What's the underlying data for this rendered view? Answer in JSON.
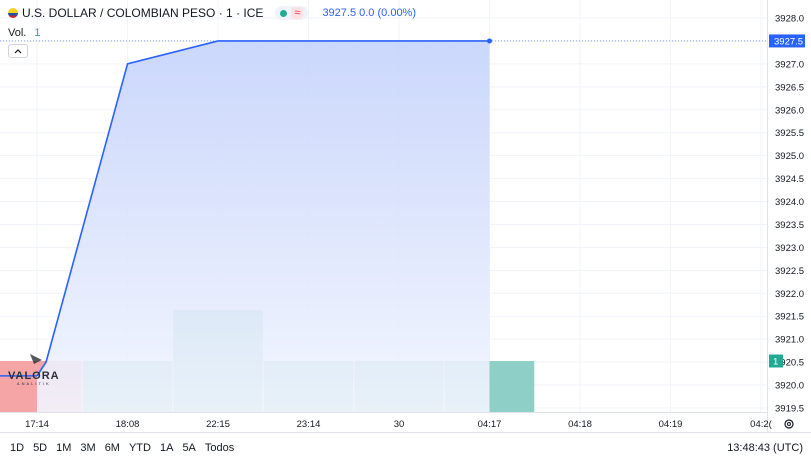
{
  "legend": {
    "symbol_title": "U.S. DOLLAR / COLOMBIAN PESO · 1 · ICE",
    "eq_badge": "≈",
    "quote": "3927.5  0.0 (0.00%)",
    "flag_icon": "colombia-flag-icon"
  },
  "volume": {
    "label": "Vol.",
    "value": "1",
    "badge": "1"
  },
  "watermark": {
    "name": "VALORA",
    "sub": "ANALITIK"
  },
  "price_badge": "3927.5",
  "colors": {
    "line": "#2962ff",
    "fill_top": "#c5d3fb",
    "fill_bottom": "#f2f5fe",
    "volume_bar": "#8ecfc7",
    "volume_bar_first": "#f5a5a5",
    "price_badge_bg": "#2962ff",
    "volume_badge_bg": "#22ab94"
  },
  "bottom_bar": {
    "ranges": [
      "1D",
      "5D",
      "1M",
      "3M",
      "6M",
      "YTD",
      "1A",
      "5A",
      "Todos"
    ],
    "clock": "13:48:43 (UTC)"
  },
  "chart_data": {
    "type": "area",
    "x_labels": [
      "17:14",
      "18:08",
      "22:15",
      "23:14",
      "30",
      "04:17",
      "04:18",
      "04:19",
      "04:2("
    ],
    "y_ticks": [
      "3928.0",
      "3927.5",
      "3927.0",
      "3926.5",
      "3926.0",
      "3925.5",
      "3925.0",
      "3924.5",
      "3924.0",
      "3923.5",
      "3923.0",
      "3922.5",
      "3922.0",
      "3921.5",
      "3921.0",
      "3920.5",
      "3920.0",
      "3919.5"
    ],
    "ylim": [
      3919.5,
      3928.0
    ],
    "series": [
      {
        "x_index": [
          0,
          0.1,
          1,
          2,
          3,
          4,
          5
        ],
        "values": [
          3920.2,
          3920.5,
          3927.0,
          3927.5,
          3927.5,
          3927.5,
          3927.5
        ]
      }
    ],
    "volume": {
      "x_index": [
        0,
        1,
        2,
        3,
        4,
        5
      ],
      "values": [
        1,
        1,
        2,
        1,
        1,
        1
      ],
      "max": 2
    }
  }
}
